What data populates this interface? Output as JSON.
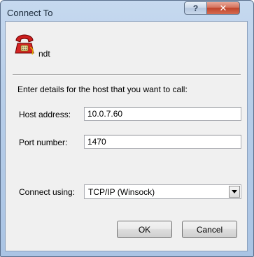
{
  "window": {
    "title": "Connect To",
    "help_glyph": "?",
    "close_glyph": "✕"
  },
  "connection": {
    "icon": "telephone-icon",
    "name": "ndt"
  },
  "instructions": "Enter details for the host that you want to call:",
  "host": {
    "label": "Host address:",
    "value": "10.0.7.60"
  },
  "port": {
    "label": "Port number:",
    "value": "1470"
  },
  "connect_using": {
    "label": "Connect using:",
    "value": "TCP/IP (Winsock)"
  },
  "buttons": {
    "ok": "OK",
    "cancel": "Cancel"
  },
  "colors": {
    "accent_frame": "#aac4e4",
    "close_red": "#c0432a",
    "dialog_bg": "#f0f0f0"
  }
}
